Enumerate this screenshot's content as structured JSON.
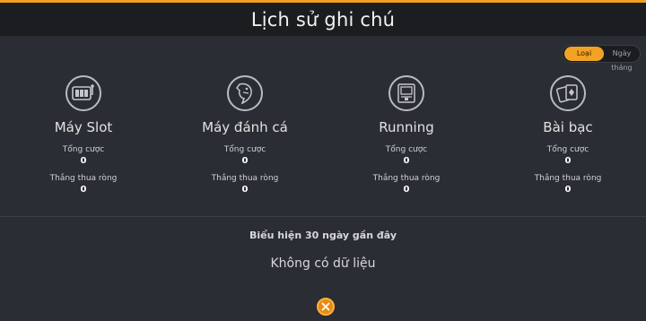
{
  "header": {
    "title": "Lịch sử ghi chú"
  },
  "toggle": {
    "options": [
      "Loại",
      "Ngày tháng"
    ]
  },
  "categories": [
    {
      "name": "Máy Slot",
      "icon": "slot-machine-icon",
      "total_bet_label": "Tổng cược",
      "total_bet": "0",
      "net_label": "Thắng thua ròng",
      "net": "0"
    },
    {
      "name": "Máy đánh cá",
      "icon": "shark-icon",
      "total_bet_label": "Tổng cược",
      "total_bet": "0",
      "net_label": "Thắng thua ròng",
      "net": "0"
    },
    {
      "name": "Running",
      "icon": "arcade-machine-icon",
      "total_bet_label": "Tổng cược",
      "total_bet": "0",
      "net_label": "Thắng thua ròng",
      "net": "0"
    },
    {
      "name": "Bài bạc",
      "icon": "playing-cards-icon",
      "total_bet_label": "Tổng cược",
      "total_bet": "0",
      "net_label": "Thắng thua ròng",
      "net": "0"
    }
  ],
  "stats": {
    "title": "Biểu hiện 30 ngày gần đây",
    "empty_text": "Không có dữ liệu"
  },
  "colors": {
    "accent": "#f2a325",
    "background": "#2a2d33",
    "header": "#1c1d21"
  }
}
